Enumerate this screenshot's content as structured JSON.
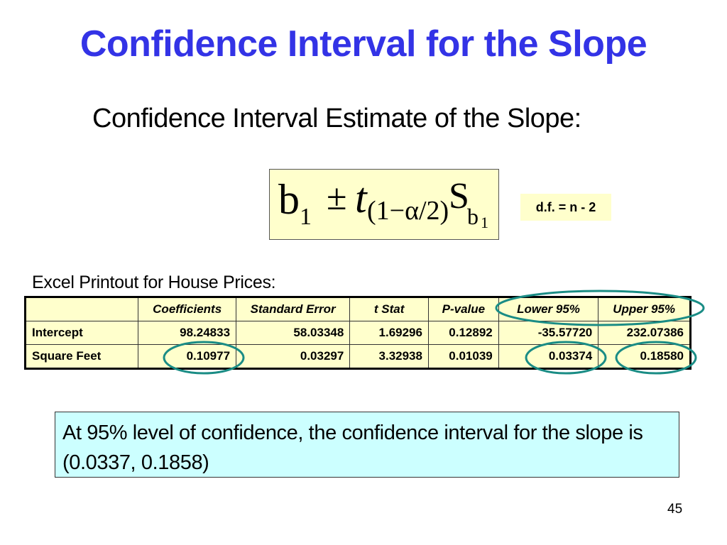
{
  "slide": {
    "title": "Confidence Interval for the Slope",
    "subtitle": "Confidence Interval Estimate of the Slope:",
    "formula": {
      "b": "b",
      "b_sub": "1",
      "pm": "±",
      "t": "t",
      "t_sub": "(1−α/2)",
      "s": "S",
      "s_sub": "b",
      "s_sub_sub": "1"
    },
    "df_note": "d.f. = n - 2",
    "excel_label": "Excel Printout for House Prices:",
    "table": {
      "headers": [
        "",
        "Coefficients",
        "Standard Error",
        "t Stat",
        "P-value",
        "Lower 95%",
        "Upper 95%"
      ],
      "rows": [
        [
          "Intercept",
          "98.24833",
          "58.03348",
          "1.69296",
          "0.12892",
          "-35.57720",
          "232.07386"
        ],
        [
          "Square Feet",
          "0.10977",
          "0.03297",
          "3.32938",
          "0.01039",
          "0.03374",
          "0.18580"
        ]
      ],
      "highlighted_cells": [
        "Lower 95% / Upper 95% headers",
        "Square Feet Coefficients",
        "Square Feet Lower 95%",
        "Square Feet Upper 95%"
      ]
    },
    "conclusion": "At 95% level of confidence, the confidence interval for the slope is (0.0337, 0.1858)",
    "page_number": "45"
  },
  "colors": {
    "title": "#3333e6",
    "formula_bg": "#ffffcc",
    "table_bg": "#ffffcc",
    "conclusion_bg": "#ccffff",
    "highlight_oval": "#1a8c85"
  }
}
